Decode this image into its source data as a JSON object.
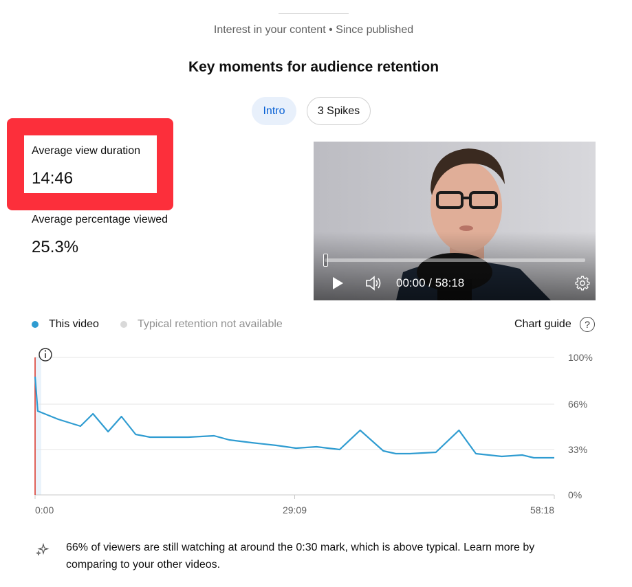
{
  "header": {
    "subtitle": "Interest in your content • Since published",
    "title": "Key moments for audience retention"
  },
  "chips": [
    {
      "label": "Intro",
      "selected": true
    },
    {
      "label": "3 Spikes",
      "selected": false
    }
  ],
  "metrics": {
    "avg_view_duration": {
      "label": "Average view duration",
      "value": "14:46",
      "highlighted": true,
      "highlight_color": "#fc2f3b"
    },
    "avg_percentage_viewed": {
      "label": "Average percentage viewed",
      "value": "25.3%"
    }
  },
  "video": {
    "time_display": "00:00 / 58:18",
    "progress": 0,
    "icons": [
      "play-icon",
      "volume-icon",
      "settings-icon"
    ]
  },
  "legend": {
    "this_video": {
      "label": "This video",
      "color": "#2f9cd1"
    },
    "typical": {
      "label": "Typical retention not available",
      "color": "#d9d9d9"
    }
  },
  "chart_guide": {
    "label": "Chart guide",
    "icon": "help-circle-icon"
  },
  "chart_data": {
    "type": "line",
    "series": [
      {
        "name": "This video",
        "color": "#2f9cd1",
        "x": [
          0,
          0.3,
          2.6,
          5.1,
          6.5,
          8.2,
          9.7,
          11.3,
          12.9,
          14.8,
          17.2,
          20.1,
          21.8,
          24.3,
          27.1,
          29.3,
          31.6,
          34.2,
          36.5,
          39.1,
          40.5,
          42.1,
          45.0,
          47.6,
          49.5,
          52.4,
          54.7,
          56.0,
          58.3
        ],
        "y": [
          86,
          61,
          55,
          50,
          59,
          46,
          57,
          44,
          42,
          42,
          42,
          43,
          40,
          38,
          36,
          34,
          35,
          33,
          47,
          32,
          30,
          30,
          31,
          47,
          30,
          28,
          29,
          27,
          27
        ]
      }
    ],
    "x_ticks": [
      "0:00",
      "29:09",
      "58:18"
    ],
    "y_ticks": [
      "100%",
      "66%",
      "33%",
      "0%"
    ],
    "ylim": [
      0,
      100
    ],
    "xlim_minutes": [
      0,
      58.3
    ],
    "highlight_range": "0:00 – 0:30",
    "grid": true,
    "info_icon": "info-icon"
  },
  "insight": {
    "icon": "sparkle-icon",
    "text": "66% of viewers are still watching at around the 0:30 mark, which is above typical. Learn more by comparing to your other videos."
  }
}
